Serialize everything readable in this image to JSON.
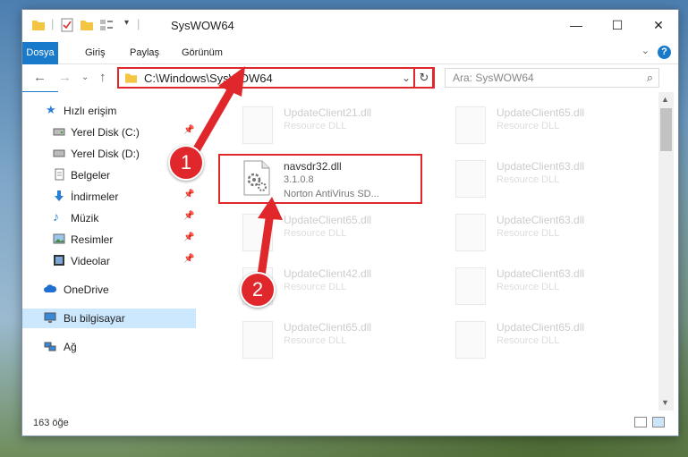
{
  "window": {
    "title": "SysWOW64"
  },
  "ribbon": {
    "tabs": [
      "Dosya",
      "Giriş",
      "Paylaş",
      "Görünüm"
    ]
  },
  "nav": {
    "address": "C:\\Windows\\SysWOW64",
    "search_placeholder": "Ara: SysWOW64"
  },
  "sidebar": {
    "items": [
      {
        "label": "Hızlı erişim",
        "icon": "star-icon"
      },
      {
        "label": "Yerel Disk (C:)",
        "icon": "drive-icon",
        "pinned": true
      },
      {
        "label": "Yerel Disk (D:)",
        "icon": "drive-icon"
      },
      {
        "label": "Belgeler",
        "icon": "documents-icon"
      },
      {
        "label": "İndirmeler",
        "icon": "download-icon",
        "pinned": true
      },
      {
        "label": "Müzik",
        "icon": "music-icon",
        "pinned": true
      },
      {
        "label": "Resimler",
        "icon": "pictures-icon",
        "pinned": true
      },
      {
        "label": "Videolar",
        "icon": "video-icon",
        "pinned": true
      },
      {
        "label": "OneDrive",
        "icon": "cloud-icon"
      },
      {
        "label": "Bu bilgisayar",
        "icon": "computer-icon",
        "selected": true
      },
      {
        "label": "Ağ",
        "icon": "network-icon"
      }
    ]
  },
  "files": {
    "highlighted": {
      "name": "navsdr32.dll",
      "version": "3.1.0.8",
      "description": "Norton AntiVirus SD..."
    },
    "others": [
      {
        "name": "UpdateClient21.dll",
        "desc": "Resource DLL"
      },
      {
        "name": "UpdateClient65.dll",
        "desc": "Resource DLL"
      },
      {
        "name": "UpdateClient63.dll",
        "desc": "Resource DLL"
      },
      {
        "name": "UpdateClient65.dll",
        "desc": "Resource DLL"
      },
      {
        "name": "UpdateClient63.dll",
        "desc": "Resource DLL"
      },
      {
        "name": "UpdateClient42.dll",
        "desc": "Resource DLL"
      },
      {
        "name": "UpdateClient63.dll",
        "desc": "Resource DLL"
      },
      {
        "name": "UpdateClient65.dll",
        "desc": "Resource DLL"
      },
      {
        "name": "UpdateClient65.dll",
        "desc": "Resource DLL"
      }
    ]
  },
  "status": {
    "count": "163 öğe"
  },
  "callouts": {
    "one": "1",
    "two": "2"
  },
  "colors": {
    "accent": "#1979ca",
    "highlight": "#e0282c",
    "selected": "#cce8ff"
  }
}
